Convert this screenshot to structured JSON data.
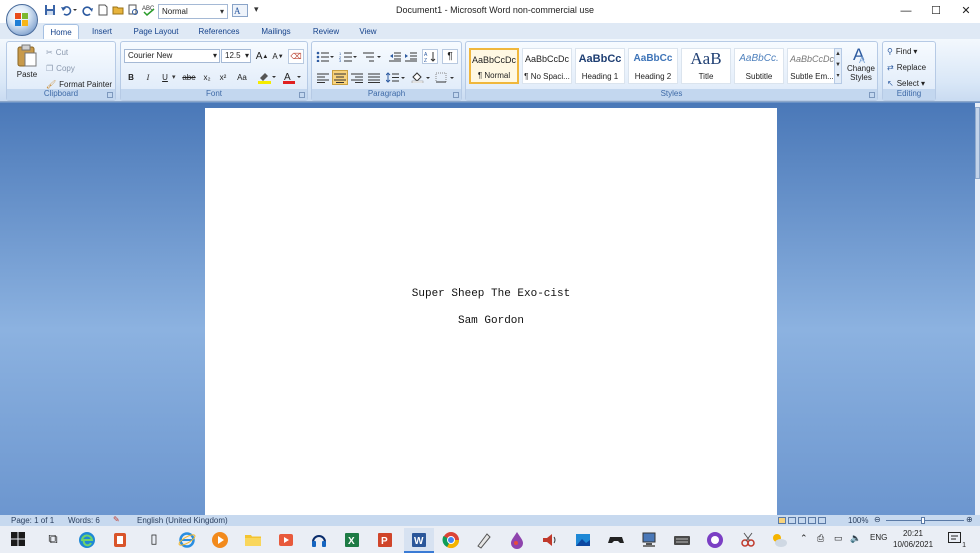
{
  "window": {
    "title": "Document1 - Microsoft Word non-commercial use",
    "controls": {
      "minimize": "—",
      "maximize": "☐",
      "close": "✕"
    }
  },
  "quick_access": {
    "style_value": "Normal"
  },
  "tabs": [
    "Home",
    "Insert",
    "Page Layout",
    "References",
    "Mailings",
    "Review",
    "View"
  ],
  "ribbon": {
    "clipboard": {
      "label": "Clipboard",
      "paste": "Paste",
      "cut": "Cut",
      "copy": "Copy",
      "format_painter": "Format Painter"
    },
    "font": {
      "label": "Font",
      "font_name": "Courier New",
      "font_size": "12.5",
      "bold": "B",
      "italic": "I",
      "underline": "U",
      "strike": "abe",
      "subscript": "x₂",
      "superscript": "x²",
      "change_case": "Aa",
      "grow": "A",
      "shrink": "A"
    },
    "paragraph": {
      "label": "Paragraph",
      "show_marks": "¶"
    },
    "styles": {
      "label": "Styles",
      "items": [
        {
          "sample": "AaBbCcDc",
          "name": "¶ Normal"
        },
        {
          "sample": "AaBbCcDc",
          "name": "¶ No Spaci..."
        },
        {
          "sample": "AaBbCc",
          "name": "Heading 1"
        },
        {
          "sample": "AaBbCc",
          "name": "Heading 2"
        },
        {
          "sample": "AaB",
          "name": "Title"
        },
        {
          "sample": "AaBbCc.",
          "name": "Subtitle"
        },
        {
          "sample": "AaBbCcDc",
          "name": "Subtle Em..."
        }
      ],
      "change_styles": "Change Styles"
    },
    "editing": {
      "label": "Editing",
      "find": "Find",
      "replace": "Replace",
      "select": "Select"
    }
  },
  "document": {
    "title_line": "Super Sheep The Exo-cist",
    "author_line": "Sam Gordon"
  },
  "status": {
    "page": "Page: 1 of 1",
    "words": "Words: 6",
    "language": "English (United Kingdom)",
    "zoom": "100%"
  },
  "taskbar": {
    "language": "ENG",
    "time": "20:21",
    "date": "10/06/2021",
    "notifications": "1"
  }
}
